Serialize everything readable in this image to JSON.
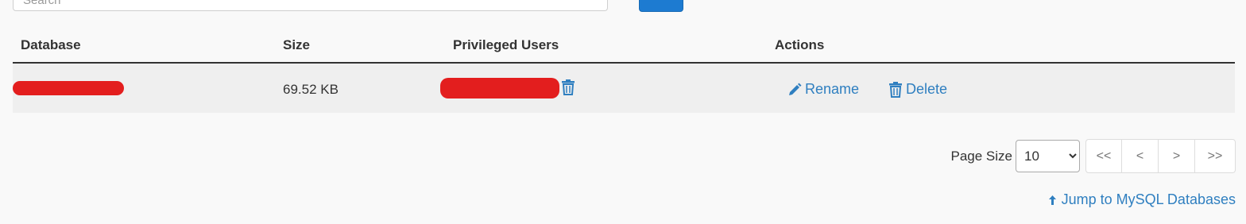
{
  "search": {
    "placeholder": "Search"
  },
  "table": {
    "headers": {
      "database": "Database",
      "size": "Size",
      "privileged_users": "Privileged Users",
      "actions": "Actions"
    },
    "rows": [
      {
        "database": "",
        "size": "69.52 KB",
        "privileged_user": "",
        "rename_label": "Rename",
        "delete_label": "Delete"
      }
    ]
  },
  "pagination": {
    "page_size_label": "Page Size",
    "page_size_value": "10",
    "first": "<<",
    "prev": "<",
    "next": ">",
    "last": ">>"
  },
  "jump_link": "Jump to MySQL Databases",
  "colors": {
    "link": "#2f7fc0",
    "redaction": "#e31e1e",
    "primary_button": "#1d7bd1"
  },
  "icons": [
    "trash-icon",
    "pencil-icon",
    "arrow-up-icon",
    "chevron-down-icon"
  ]
}
